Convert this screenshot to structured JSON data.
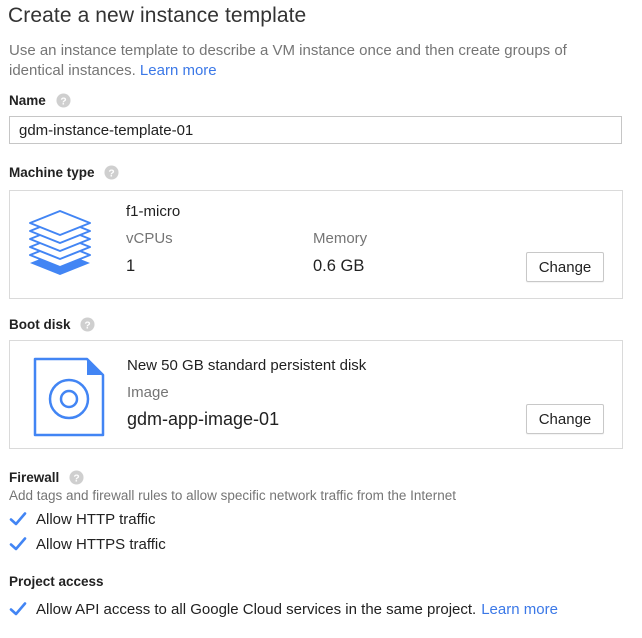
{
  "header": {
    "title": "Create a new instance template",
    "intro_text": "Use an instance template to describe a VM instance once and then create groups of identical instances.",
    "intro_link": "Learn more"
  },
  "name_section": {
    "label": "Name",
    "help_icon": "question-mark-icon",
    "value": "gdm-instance-template-01"
  },
  "machine_type": {
    "label": "Machine type",
    "help_icon": "question-mark-icon",
    "icon": "stacked-layers-icon",
    "name": "f1-micro",
    "vcpus_label": "vCPUs",
    "vcpus_value": "1",
    "memory_label": "Memory",
    "memory_value": "0.6 GB",
    "change_label": "Change"
  },
  "boot_disk": {
    "label": "Boot disk",
    "help_icon": "question-mark-icon",
    "icon": "disk-file-icon",
    "description": "New 50 GB standard persistent disk",
    "image_label": "Image",
    "image_value": "gdm-app-image-01",
    "change_label": "Change"
  },
  "firewall": {
    "label": "Firewall",
    "help_icon": "question-mark-icon",
    "description": "Add tags and firewall rules to allow specific network traffic from the Internet",
    "options": [
      {
        "label": "Allow HTTP traffic",
        "checked": true
      },
      {
        "label": "Allow HTTPS traffic",
        "checked": true
      }
    ]
  },
  "project_access": {
    "label": "Project access",
    "option_label": "Allow API access to all Google Cloud services in the same project.",
    "option_link": "Learn more",
    "checked": true
  },
  "colors": {
    "accent": "#4285f4",
    "link": "#3b78e7",
    "secondary_text": "#757575",
    "border": "#dadada"
  }
}
